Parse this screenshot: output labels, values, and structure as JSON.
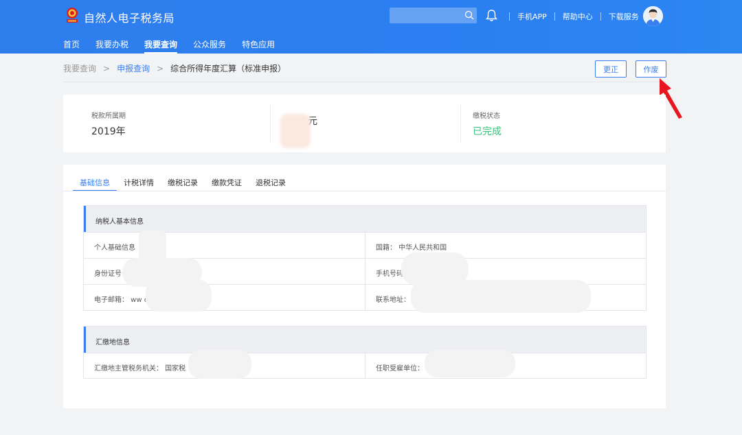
{
  "header": {
    "app_title": "自然人电子税务局",
    "search_placeholder": "",
    "links": [
      "手机APP",
      "帮助中心",
      "下载服务"
    ],
    "nav": [
      {
        "label": "首页",
        "active": false
      },
      {
        "label": "我要办税",
        "active": false
      },
      {
        "label": "我要查询",
        "active": true
      },
      {
        "label": "公众服务",
        "active": false
      },
      {
        "label": "特色应用",
        "active": false
      }
    ]
  },
  "breadcrumb": {
    "items": [
      "我要查询",
      "申报查询",
      "综合所得年度汇算（标准申报）"
    ],
    "separator": ">"
  },
  "actions": {
    "correct_label": "更正",
    "void_label": "作废"
  },
  "summary": {
    "period_label": "税款所属期",
    "period_value": "2019年",
    "amount_label": "",
    "amount_value": "元",
    "status_label": "缴税状态",
    "status_value": "已完成"
  },
  "tabs": [
    "基础信息",
    "计税详情",
    "缴税记录",
    "缴款凭证",
    "退税记录"
  ],
  "basic_info": {
    "title": "纳税人基本信息",
    "rows": [
      [
        "个人基础信息",
        "国籍：  中华人民共和国"
      ],
      [
        "身份证号",
        "手机号码"
      ],
      [
        "电子邮箱：  ww                          om",
        "联系地址："
      ]
    ]
  },
  "remit_info": {
    "title": "汇缴地信息",
    "rows": [
      [
        "汇缴地主管税务机关：  国家税",
        "任职受雇单位："
      ]
    ]
  },
  "colors": {
    "brand": "#2f7dec",
    "accent": "#3a7ff0",
    "success": "#3cc27d",
    "annotation": "#e8161f"
  }
}
